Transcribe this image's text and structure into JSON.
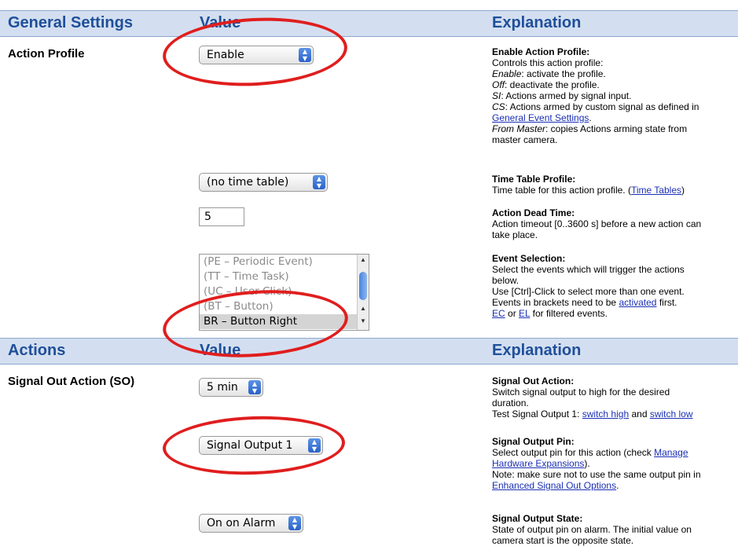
{
  "header1": {
    "col1": "General Settings",
    "col2": "Value",
    "col3": "Explanation"
  },
  "header2": {
    "col1": "Actions",
    "col2": "Value",
    "col3": "Explanation"
  },
  "rows": {
    "action_profile_label": "Action Profile",
    "signal_out_label": "Signal Out Action (SO)"
  },
  "controls": {
    "action_profile_select": "Enable",
    "time_table_select": "(no time table)",
    "dead_time_value": "5",
    "event_list": [
      "(PE – Periodic Event)",
      "(TT – Time Task)",
      "(UC – User Click)",
      "(BT – Button)",
      "BR – Button Right"
    ],
    "event_selected": "BR – Button Right",
    "signal_duration_select": "5 min",
    "signal_output_select": "Signal Output 1",
    "signal_state_select": "On on Alarm"
  },
  "explanations": {
    "enable": {
      "title": "Enable Action Profile:",
      "l1": "Controls this action profile:",
      "l2_em": "Enable",
      "l2": ": activate the profile.",
      "l3_em": "Off",
      "l3": ": deactivate the profile.",
      "l4_em": "SI",
      "l4": ": Actions armed by signal input.",
      "l5_em": "CS",
      "l5": ": Actions armed by custom signal as defined in",
      "l6_link": "General Event Settings",
      "l6": ".",
      "l7_em": "From Master",
      "l7": ": copies Actions arming state from",
      "l8": "master camera."
    },
    "time_table": {
      "title": "Time Table Profile:",
      "l1": "Time table for this action profile. (",
      "l1_link": "Time Tables",
      "l1_end": ")"
    },
    "dead_time": {
      "title": "Action Dead Time:",
      "l1": "Action timeout [0..3600 s] before a new action can",
      "l2": "take place."
    },
    "event_selection": {
      "title": "Event Selection:",
      "l1": "Select the events which will trigger the actions",
      "l2": "below.",
      "l3": "Use [Ctrl]-Click to select more than one event.",
      "l4": "Events in brackets need to be",
      "l4_link": "activated",
      "l4_end": "first.",
      "l5_link1": "EC",
      "l5_or": "or",
      "l5_link2": "EL",
      "l5_end": "for filtered events."
    },
    "signal_out": {
      "title": "Signal Out Action:",
      "l1": "Switch signal output to high for the desired",
      "l2": "duration.",
      "l3": "Test Signal Output 1:",
      "l3_link1": "switch high",
      "l3_and": "and",
      "l3_link2": "switch low"
    },
    "output_pin": {
      "title": "Signal Output Pin:",
      "l1": "Select output pin for this action (check",
      "l1_link": "Manage",
      "l2_link": "Hardware Expansions",
      "l2": ").",
      "l3": "Note: make sure not to use the same output pin in",
      "l4_link": "Enhanced Signal Out Options",
      "l4": "."
    },
    "output_state": {
      "title": "Signal Output State:",
      "l1": "State of output pin on alarm. The initial value on",
      "l2": "camera start is the opposite state."
    }
  },
  "colors": {
    "header_bg": "#d3dff0",
    "header_text": "#1f4f9a",
    "annotation": "#e01e1e",
    "link": "#1a2fb5"
  }
}
